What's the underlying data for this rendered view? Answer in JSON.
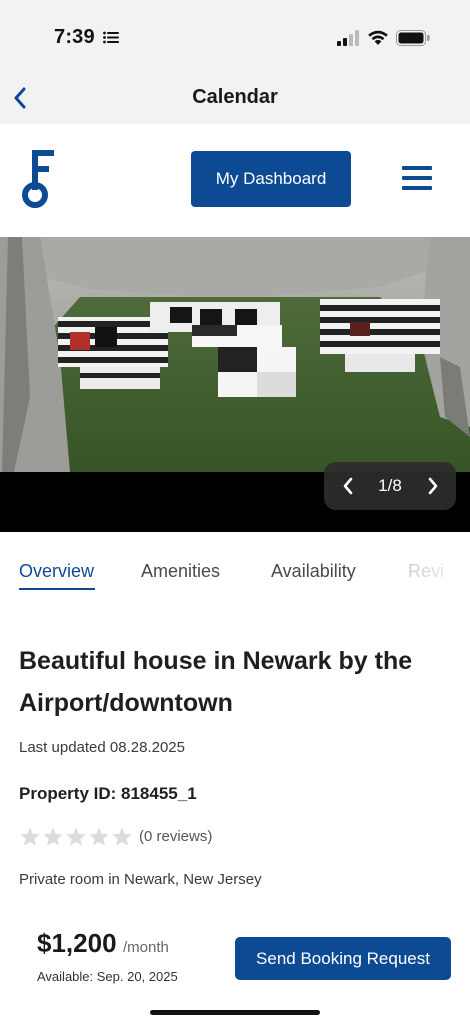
{
  "status_bar": {
    "time": "7:39"
  },
  "nav": {
    "title": "Calendar",
    "back_icon": "chevron-left-icon"
  },
  "header": {
    "dashboard_label": "My Dashboard",
    "menu_icon": "hamburger-menu-icon",
    "logo_icon": "key-logo-icon"
  },
  "gallery": {
    "counter": "1/8",
    "current_photo": 1,
    "total_photos": 8,
    "photo_caption": "Tent lounge with striped sofas on grass"
  },
  "tabs": [
    {
      "label": "Overview",
      "active": true
    },
    {
      "label": "Amenities",
      "active": false
    },
    {
      "label": "Availability",
      "active": false
    },
    {
      "label": "Revi",
      "active": false
    }
  ],
  "listing": {
    "title": "Beautiful house in Newark by the Airport/downtown",
    "last_updated": "Last updated 08.28.2025",
    "property_id": "Property ID: 818455_1",
    "rating_stars_filled": 0,
    "rating_stars_total": 5,
    "reviews": "(0 reviews)",
    "room_location": "Private room in Newark, New Jersey"
  },
  "booking": {
    "price": "$1,200",
    "price_unit": "/month",
    "available": "Available: Sep. 20, 2025",
    "button_label": "Send Booking Request"
  },
  "colors": {
    "brand": "#0d4a94",
    "status_bar_bg": "#f2f2f2",
    "star_empty": "#dcdcdc"
  }
}
